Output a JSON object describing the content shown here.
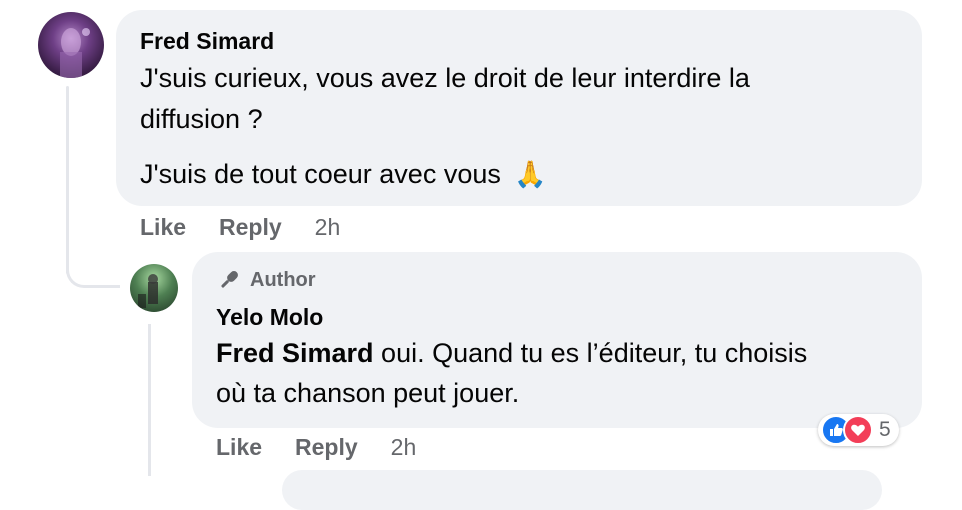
{
  "comment": {
    "author": "Fred Simard",
    "line1": "J'suis curieux, vous avez le droit de leur interdire la",
    "line2": "diffusion ?",
    "line3": "J'suis de tout coeur avec vous",
    "emoji": "🙏",
    "like_label": "Like",
    "reply_label": "Reply",
    "time": "2h"
  },
  "reply": {
    "badge": "Author",
    "author": "Yelo Molo",
    "mention": "Fred Simard",
    "line1_rest": " oui. Quand tu es l’éditeur, tu choisis",
    "line2": "où ta chanson peut jouer.",
    "like_label": "Like",
    "reply_label": "Reply",
    "time": "2h",
    "reaction_count": "5",
    "reaction_icons": [
      "like-icon",
      "love-icon"
    ]
  },
  "colors": {
    "bubble": "#f0f2f5",
    "meta_text": "#65676b",
    "like_blue": "#1877f2",
    "love_red": "#f33e58",
    "thread_line": "#e4e6eb"
  }
}
